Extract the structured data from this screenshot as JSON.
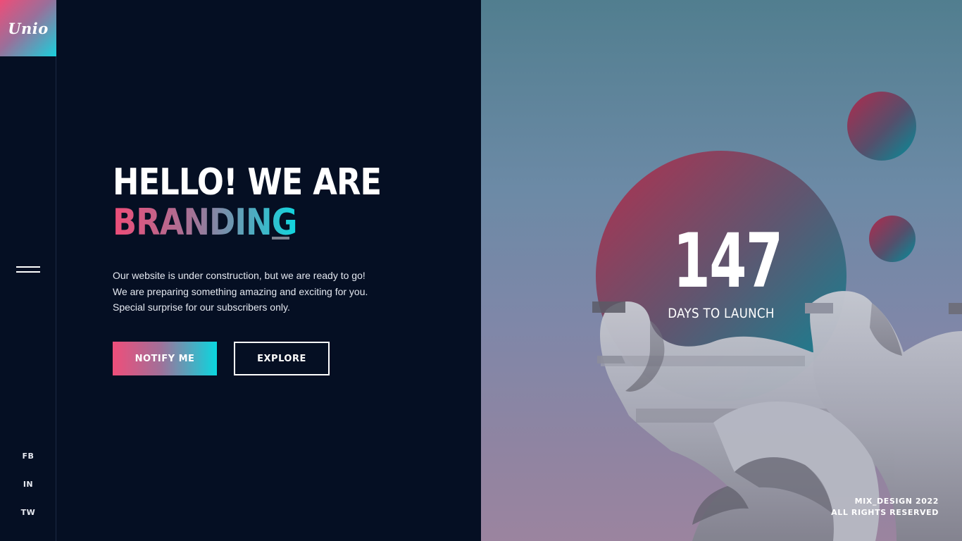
{
  "brand": {
    "logo_text": "Unio"
  },
  "nav": {
    "menu_icon": "hamburger-icon"
  },
  "social": [
    {
      "label": "FB"
    },
    {
      "label": "IN"
    },
    {
      "label": "TW"
    }
  ],
  "hero": {
    "title_line1": "HELLO! WE ARE",
    "title_line2": "BRANDING",
    "description": [
      "Our website is under construction, but we are ready to go!",
      "We are preparing something amazing and exciting for you.",
      "Special surprise for our subscribers only."
    ],
    "notify_label": "NOTIFY ME",
    "explore_label": "EXPLORE"
  },
  "countdown": {
    "value": "147",
    "label": "DAYS TO LAUNCH"
  },
  "footer": {
    "line1": "MIX_DESIGN 2022",
    "line2": "ALL RIGHTS RESERVED"
  },
  "colors": {
    "background": "#050f23",
    "accent_pink": "#ee4d78",
    "accent_cyan": "#10d6df",
    "panel_top": "#517e8f",
    "panel_bottom": "#9b849f"
  }
}
